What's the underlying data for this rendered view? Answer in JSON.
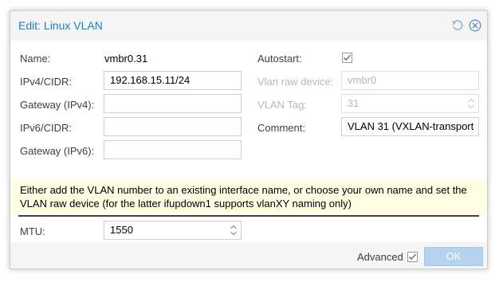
{
  "dialog": {
    "title": "Edit: Linux VLAN",
    "icons": {
      "reset": "reset-icon",
      "close": "close-icon"
    }
  },
  "form": {
    "name": {
      "label": "Name:",
      "value": "vmbr0.31"
    },
    "ipv4": {
      "label": "IPv4/CIDR:",
      "value": "192.168.15.11/24"
    },
    "gateway4": {
      "label": "Gateway (IPv4):",
      "value": ""
    },
    "ipv6": {
      "label": "IPv6/CIDR:",
      "value": ""
    },
    "gateway6": {
      "label": "Gateway (IPv6):",
      "value": ""
    },
    "autostart": {
      "label": "Autostart:",
      "checked": true
    },
    "vlan_raw_device": {
      "label": "Vlan raw device:",
      "value": "vmbr0",
      "disabled": true
    },
    "vlan_tag": {
      "label": "VLAN Tag:",
      "value": "31",
      "disabled": true
    },
    "comment": {
      "label": "Comment:",
      "value": "VLAN 31 (VXLAN-transport"
    }
  },
  "notice": "Either add the VLAN number to an existing interface name, or choose your own name and set the VLAN raw device (for the latter ifupdown1 supports vlanXY naming only)",
  "mtu": {
    "label": "MTU:",
    "value": "1550"
  },
  "footer": {
    "advanced_label": "Advanced",
    "advanced_checked": true,
    "ok_label": "OK"
  },
  "colors": {
    "title": "#157fcc",
    "notice_bg": "#fffde4",
    "ok_button_bg": "#b5d3ef"
  }
}
